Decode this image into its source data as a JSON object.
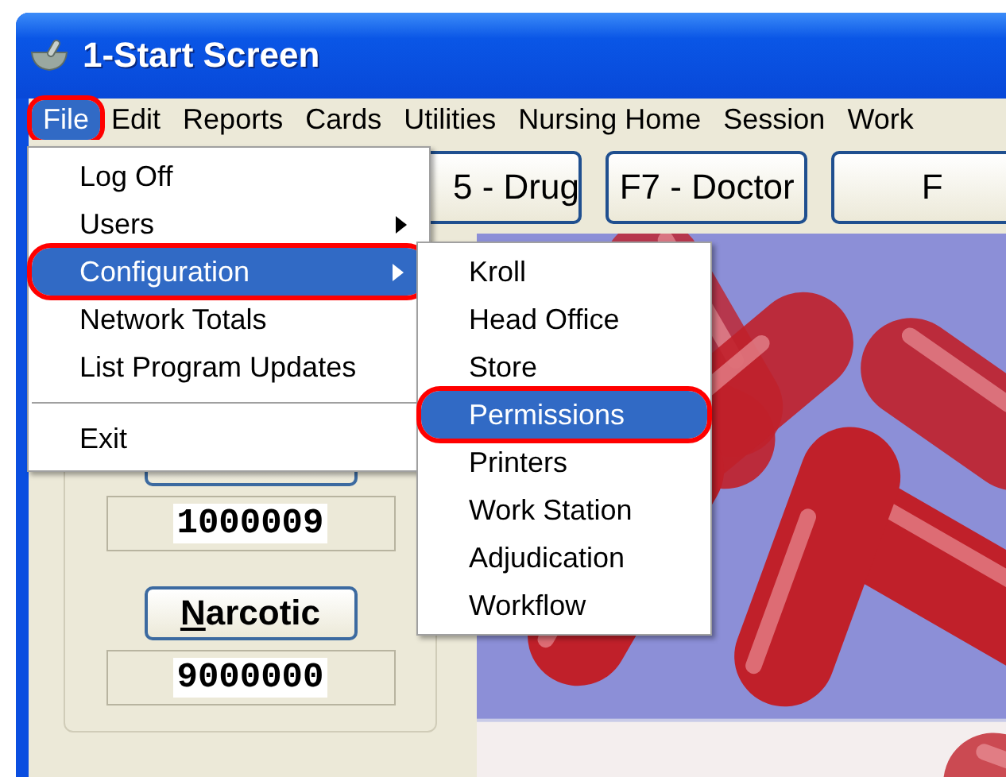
{
  "window": {
    "title": "1-Start Screen"
  },
  "menubar": [
    {
      "label": "File",
      "selected": true
    },
    {
      "label": "Edit",
      "selected": false
    },
    {
      "label": "Reports",
      "selected": false
    },
    {
      "label": "Cards",
      "selected": false
    },
    {
      "label": "Utilities",
      "selected": false
    },
    {
      "label": "Nursing Home",
      "selected": false
    },
    {
      "label": "Session",
      "selected": false
    },
    {
      "label": "Work",
      "selected": false
    }
  ],
  "toolbar": [
    "5 - Drug",
    "F7 - Doctor",
    "F"
  ],
  "counters": [
    {
      "value": "1000009"
    },
    {
      "button": "Narcotic",
      "value": "9000000"
    }
  ],
  "file_menu": [
    {
      "label": "Log Off",
      "selected": false,
      "submenu": false
    },
    {
      "label": "Users",
      "selected": false,
      "submenu": true
    },
    {
      "label": "Configuration",
      "selected": true,
      "submenu": true
    },
    {
      "label": "Network Totals",
      "selected": false,
      "submenu": false
    },
    {
      "label": "List Program Updates",
      "selected": false,
      "submenu": false
    },
    {
      "kind": "separator"
    },
    {
      "label": "Exit",
      "selected": false,
      "submenu": false
    }
  ],
  "configuration_menu": [
    {
      "label": "Kroll",
      "selected": false
    },
    {
      "label": "Head Office",
      "selected": false
    },
    {
      "label": "Store",
      "selected": false
    },
    {
      "label": "Permissions",
      "selected": true
    },
    {
      "label": "Printers",
      "selected": false
    },
    {
      "label": "Work Station",
      "selected": false
    },
    {
      "label": "Adjudication",
      "selected": false
    },
    {
      "label": "Workflow",
      "selected": false
    }
  ]
}
